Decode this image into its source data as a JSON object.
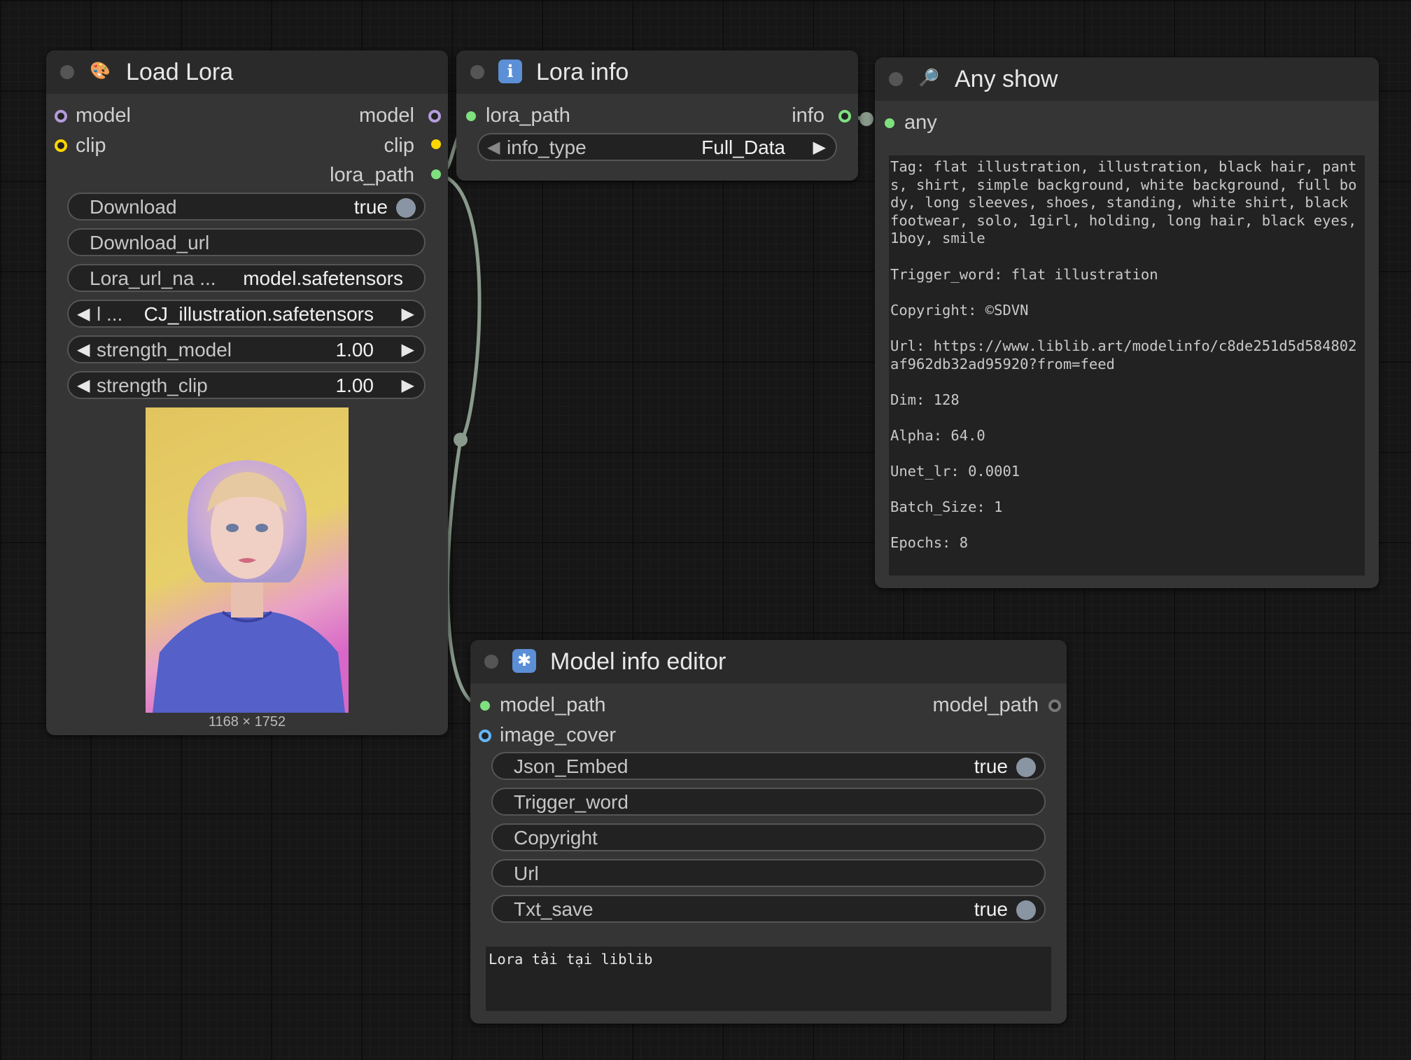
{
  "colors": {
    "model_slot": "#b39ddb",
    "clip_slot": "#ffd500",
    "string_slot": "#7fe07f",
    "image_slot": "#64b5f6",
    "wire": "#8a9a8c",
    "toggle_knob": "#8a95a3"
  },
  "load_lora": {
    "title": "Load Lora",
    "icon": "palette-icon",
    "inputs": [
      "model",
      "clip"
    ],
    "outputs": [
      "model",
      "clip",
      "lora_path"
    ],
    "widgets": {
      "download": {
        "label": "Download",
        "value": "true"
      },
      "download_url": {
        "label": "Download_url"
      },
      "lora_url_name": {
        "label": "Lora_url_na ...",
        "value": "model.safetensors"
      },
      "lora_name": {
        "label": "l ...",
        "value": "CJ_illustration.safetensors"
      },
      "strength_model": {
        "label": "strength_model",
        "value": "1.00"
      },
      "strength_clip": {
        "label": "strength_clip",
        "value": "1.00"
      }
    },
    "preview": {
      "caption": "1168 × 1752",
      "image": "portrait of a girl with bob haircut in blue t-shirt"
    }
  },
  "lora_info": {
    "title": "Lora info",
    "icon": "info-icon",
    "inputs": [
      "lora_path"
    ],
    "outputs": [
      "info"
    ],
    "widgets": {
      "info_type": {
        "label": "info_type",
        "value": "Full_Data"
      }
    }
  },
  "any_show": {
    "title": "Any show",
    "icon": "magnifier-icon",
    "inputs": [
      "any"
    ],
    "text": "Tag: flat illustration, illustration, black hair, pants, shirt, simple background, white background, full body, long sleeves, shoes, standing, white shirt, black footwear, solo, 1girl, holding, long hair, black eyes, 1boy, smile\n\nTrigger_word: flat illustration\n\nCopyright: ©SDVN\n\nUrl: https://www.liblib.art/modelinfo/c8de251d5d584802af962db32ad95920?from=feed\n\nDim: 128\n\nAlpha: 64.0\n\nUnet_lr: 0.0001\n\nBatch_Size: 1\n\nEpochs: 8"
  },
  "model_info_editor": {
    "title": "Model info editor",
    "icon": "asterisk-icon",
    "inputs": [
      "model_path",
      "image_cover"
    ],
    "outputs": [
      "model_path"
    ],
    "widgets": {
      "json_embed": {
        "label": "Json_Embed",
        "value": "true"
      },
      "trigger_word": {
        "label": "Trigger_word"
      },
      "copyright": {
        "label": "Copyright"
      },
      "url": {
        "label": "Url"
      },
      "txt_save": {
        "label": "Txt_save",
        "value": "true"
      }
    },
    "text": "Lora tải tại liblib"
  }
}
